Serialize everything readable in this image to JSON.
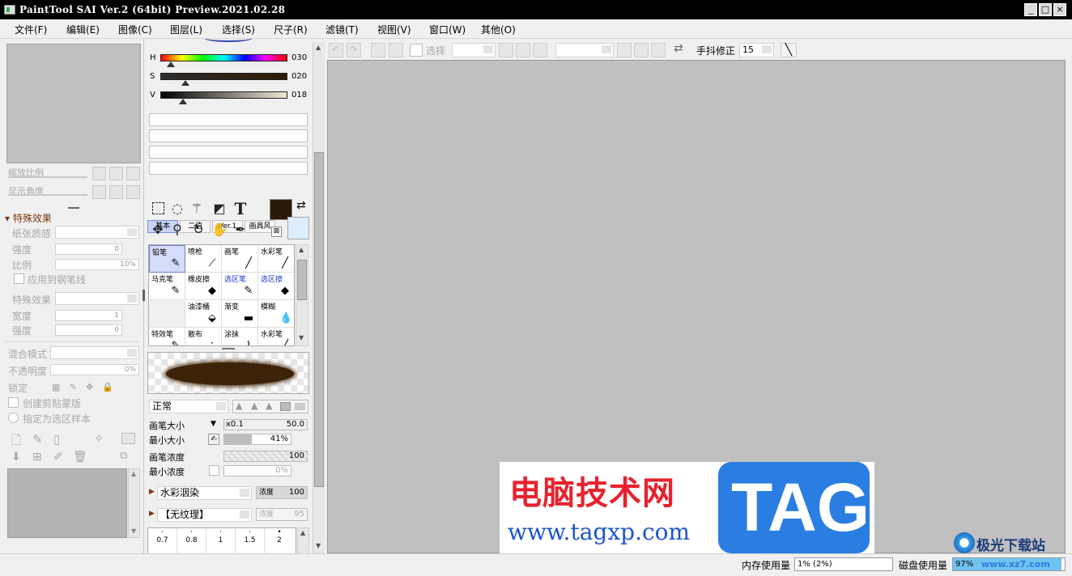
{
  "window": {
    "title": "PaintTool SAI Ver.2 (64bit) Preview.2021.02.28",
    "controls": [
      "_",
      "□",
      "×"
    ]
  },
  "menu": [
    "文件(F)",
    "编辑(E)",
    "图像(C)",
    "图层(L)",
    "选择(S)",
    "尺子(R)",
    "滤镜(T)",
    "视图(V)",
    "窗口(W)",
    "其他(O)"
  ],
  "navigator": {
    "zoom_label": "缩放比例",
    "angle_label": "显示角度"
  },
  "special_effects": {
    "header": "特殊效果",
    "paper_texture_label": "纸张质感",
    "strength_label": "强度",
    "strength_value": "0",
    "scale_label": "比例",
    "scale_value": "10%",
    "apply_to_pen_label": "应用到钢笔线",
    "effect_label": "特殊效果",
    "width_label": "宽度",
    "width_value": "1",
    "strength2_label": "强度",
    "strength2_value": "0"
  },
  "layer": {
    "blend_mode_label": "混合模式",
    "opacity_label": "不透明度",
    "opacity_value": "0%",
    "lock_label": "锁定",
    "clip_label": "创建剪贴蒙版",
    "sample_label": "指定为选区样本"
  },
  "color": {
    "h_label": "H",
    "h_value": "030",
    "h_level": 0.083,
    "s_label": "S",
    "s_value": "020",
    "s_level": 0.2,
    "v_label": "V",
    "v_value": "018",
    "v_level": 0.18,
    "fg_color": "#2b1a0a",
    "bg_color": "#ddeeff"
  },
  "tool_tabs": [
    "基本",
    "二值",
    "Ver.1",
    "画具风"
  ],
  "tools": [
    "select-rect",
    "lasso",
    "magic-wand",
    "shape",
    "text",
    "move",
    "zoom",
    "rotate",
    "hand",
    "eyedropper"
  ],
  "brushes": [
    {
      "label": "铅笔",
      "icon": "pencil-icon",
      "glyph": "✎",
      "selected": true,
      "blue": false
    },
    {
      "label": "喷枪",
      "icon": "airbrush-icon",
      "glyph": "⟋",
      "selected": false,
      "blue": false
    },
    {
      "label": "画笔",
      "icon": "brush-icon",
      "glyph": "╱",
      "selected": false,
      "blue": false
    },
    {
      "label": "水彩笔",
      "icon": "watercolor-icon",
      "glyph": "╱",
      "selected": false,
      "blue": false
    },
    {
      "label": "马克笔",
      "icon": "marker-icon",
      "glyph": "✎",
      "selected": false,
      "blue": false
    },
    {
      "label": "橡皮擦",
      "icon": "eraser-icon",
      "glyph": "◆",
      "selected": false,
      "blue": false
    },
    {
      "label": "选区笔",
      "icon": "select-pen-icon",
      "glyph": "✎",
      "selected": false,
      "blue": true
    },
    {
      "label": "选区擦",
      "icon": "select-eraser-icon",
      "glyph": "◆",
      "selected": false,
      "blue": true
    },
    {
      "label": "",
      "icon": "",
      "glyph": "",
      "selected": false,
      "blue": false
    },
    {
      "label": "油漆桶",
      "icon": "bucket-icon",
      "glyph": "⬙",
      "selected": false,
      "blue": false
    },
    {
      "label": "渐变",
      "icon": "gradient-icon",
      "glyph": "▬",
      "selected": false,
      "blue": false
    },
    {
      "label": "模糊",
      "icon": "blur-icon",
      "glyph": "💧",
      "selected": false,
      "blue": false
    },
    {
      "label": "特效笔",
      "icon": "fx-pen-icon",
      "glyph": "✎",
      "selected": false,
      "blue": false
    },
    {
      "label": "散布",
      "icon": "scatter-icon",
      "glyph": "∴",
      "selected": false,
      "blue": false
    },
    {
      "label": "涂抹",
      "icon": "smudge-icon",
      "glyph": "⌇",
      "selected": false,
      "blue": false
    },
    {
      "label": "水彩笔",
      "icon": "watercolor2-icon",
      "glyph": "╱",
      "selected": false,
      "blue": false
    }
  ],
  "brush_settings": {
    "mode": "正常",
    "size_label": "画笔大小",
    "size_mult": "x0.1",
    "size_value": "50.0",
    "min_size_label": "最小大小",
    "min_size_value": "41%",
    "min_size_level": 0.41,
    "density_label": "画笔浓度",
    "density_value": "100",
    "min_density_label": "最小浓度",
    "min_density_value": "0%",
    "blend_dropdown": "水彩洇染",
    "blend_amount_label": "浓度",
    "blend_amount_value": "100",
    "texture_dropdown": "【无纹理】",
    "texture_amount_label": "浓度",
    "texture_amount_value": "95"
  },
  "brush_presets": [
    "0.7",
    "0.8",
    "1",
    "1.5",
    "2"
  ],
  "toolbar": {
    "selection_label": "选择",
    "stabilizer_label": "手抖修正",
    "stabilizer_value": "15"
  },
  "status": {
    "memory_label": "内存使用量",
    "memory_value": "1% (2%)",
    "disk_label": "磁盘使用量",
    "disk_value": "97%"
  },
  "watermark": {
    "cn_text": "电脑技术网",
    "url": "www.tagxp.com",
    "tag": "TAG",
    "corner_text": "极光下载站",
    "corner_url": "www.xz7.com"
  }
}
